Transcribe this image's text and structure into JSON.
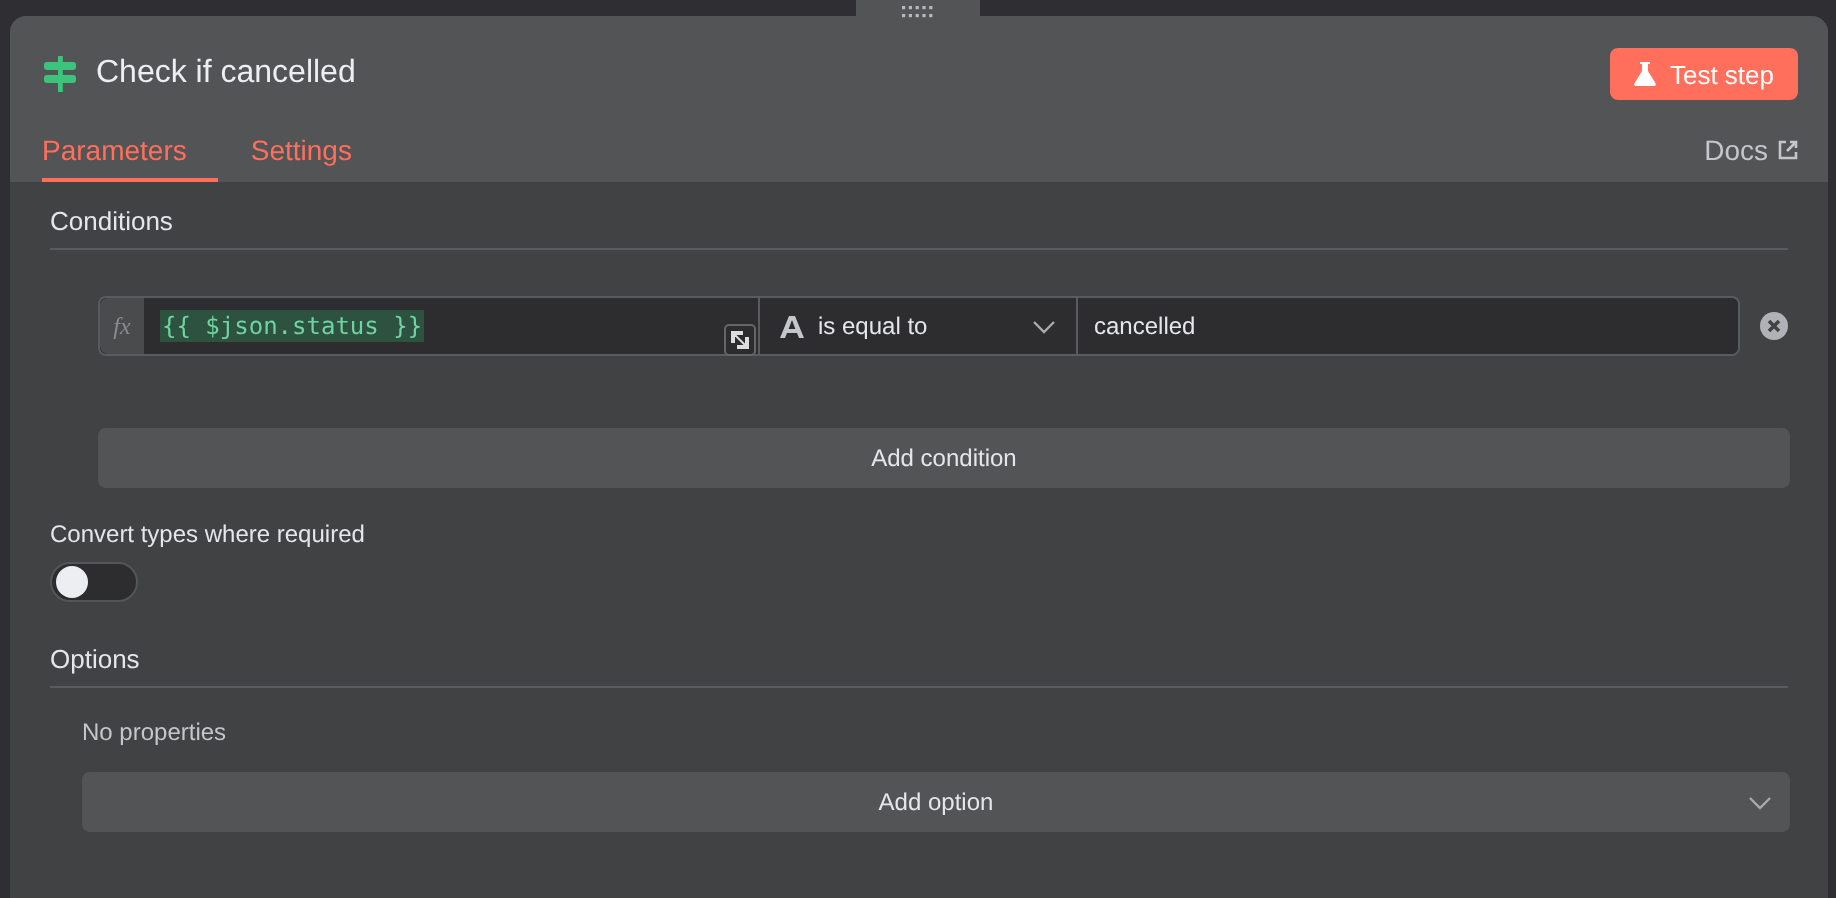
{
  "node": {
    "title": "Check if cancelled"
  },
  "test_button": {
    "label": "Test step"
  },
  "tabs": [
    {
      "label": "Parameters",
      "selected": true
    },
    {
      "label": "Settings",
      "selected": false
    }
  ],
  "docs_link": {
    "label": "Docs"
  },
  "conditions": {
    "heading": "Conditions",
    "rows": [
      {
        "fx_label": "fx",
        "expression": "{{ $json.status }}",
        "operator": "is equal to",
        "value": "cancelled"
      }
    ],
    "add_button": "Add condition"
  },
  "convert_types": {
    "label": "Convert types where required",
    "on": false
  },
  "options": {
    "heading": "Options",
    "empty_text": "No properties",
    "add_button": "Add option"
  }
}
